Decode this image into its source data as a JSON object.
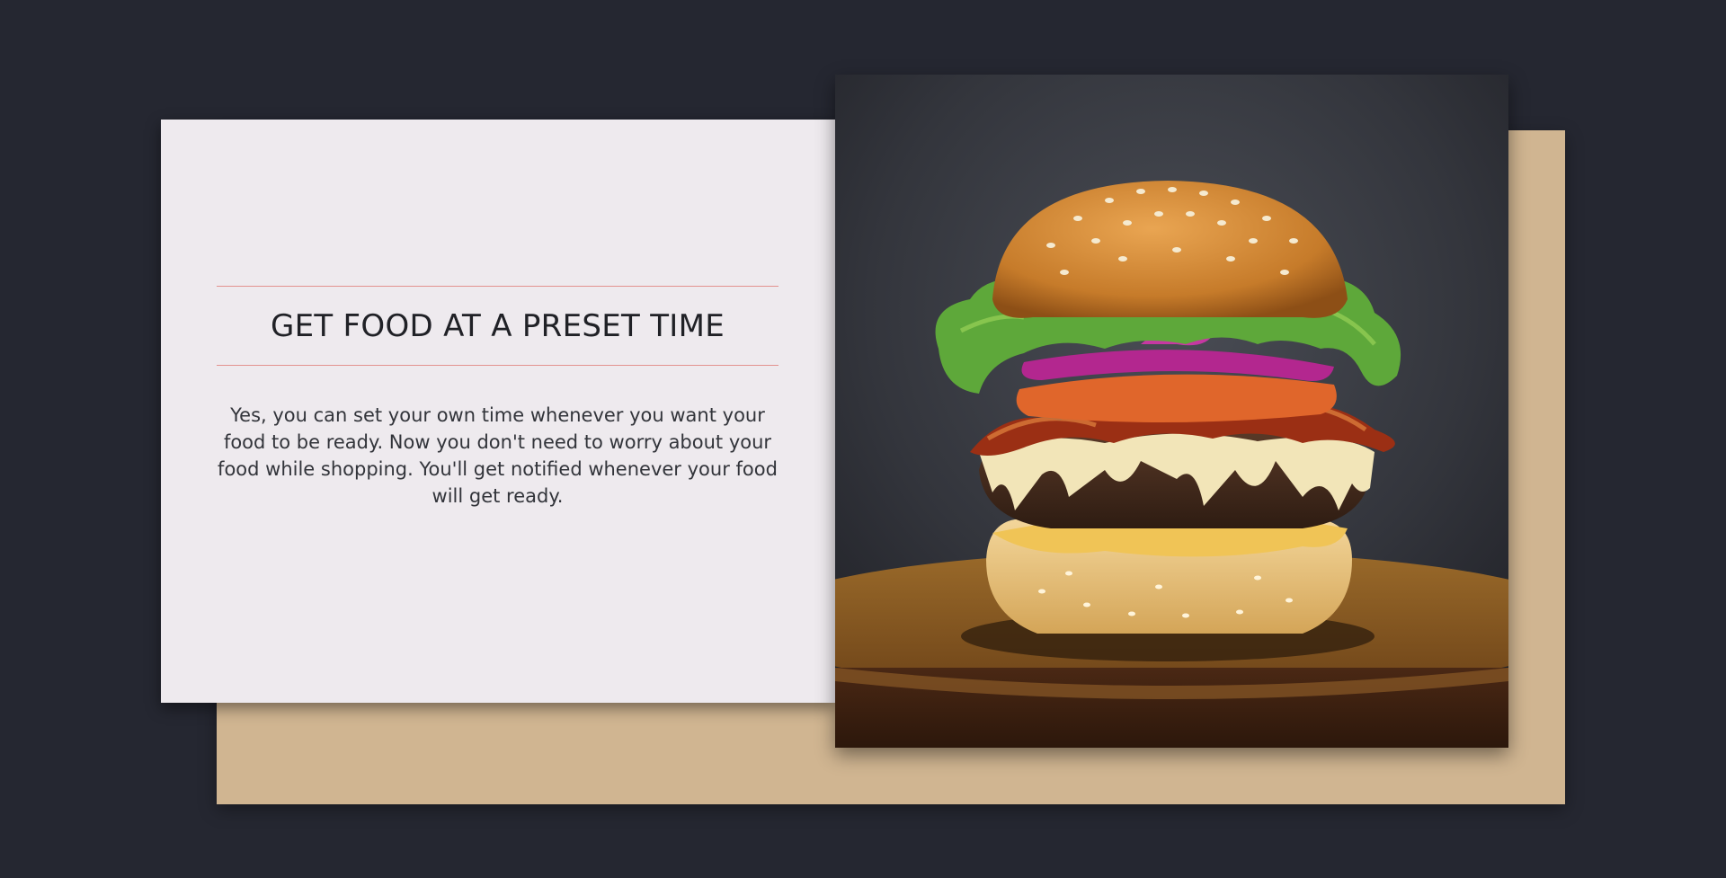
{
  "feature": {
    "title": "GET FOOD AT A PRESET TIME",
    "description": "Yes, you can set your own time whenever you want your food to be ready. Now you don't need to worry about your food while shopping. You'll get notified whenever your food will get ready."
  },
  "image": {
    "subject": "burger"
  },
  "colors": {
    "page_background": "#252731",
    "card_background": "#eeeaee",
    "backdrop_tan": "#d0b591",
    "divider": "#e2928f",
    "heading_text": "#202126",
    "body_text": "#32343a"
  }
}
